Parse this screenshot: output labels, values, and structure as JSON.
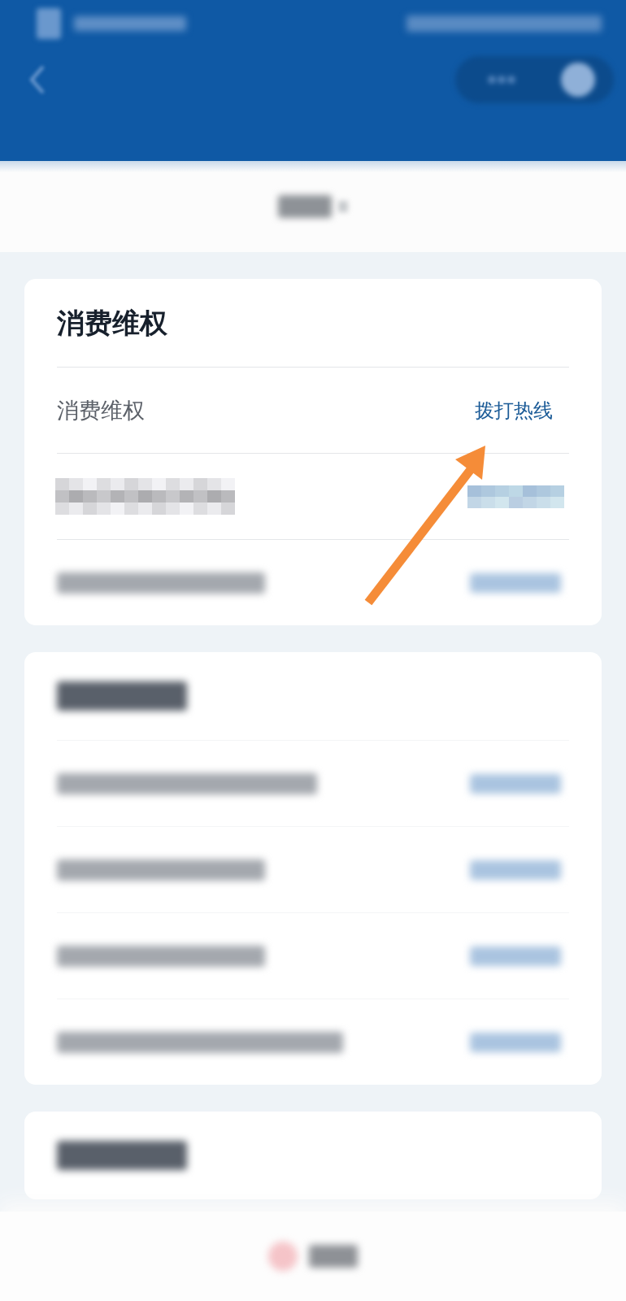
{
  "status_bar": {
    "kind": "blurred"
  },
  "nav_bar": {
    "kind": "blurred"
  },
  "tab_bar": {
    "kind": "blurred"
  },
  "sections": [
    {
      "title": {
        "kind": "text",
        "text": "消费维权"
      },
      "rows": [
        {
          "kind": "text",
          "label": "消费维权",
          "action": "拨打热线"
        },
        {
          "kind": "pixelated"
        },
        {
          "kind": "blurred"
        }
      ]
    },
    {
      "title": {
        "kind": "blurred"
      },
      "rows": [
        {
          "kind": "blurred"
        },
        {
          "kind": "blurred"
        },
        {
          "kind": "blurred"
        },
        {
          "kind": "blurred"
        }
      ]
    },
    {
      "title": {
        "kind": "blurred"
      }
    }
  ],
  "bottom_bar": {
    "kind": "blurred"
  },
  "annotations": [
    {
      "kind": "arrow"
    }
  ]
}
